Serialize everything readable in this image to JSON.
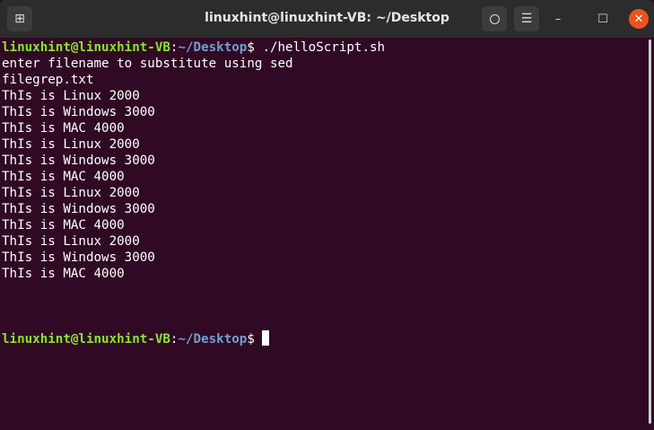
{
  "window": {
    "title": "linuxhint@linuxhint-VB: ~/Desktop"
  },
  "prompt": {
    "user": "linuxhint@linuxhint-VB",
    "sep": ":",
    "path": "~/Desktop",
    "symbol": "$ "
  },
  "command": "./helloScript.sh",
  "output": [
    "enter filename to substitute using sed",
    "filegrep.txt",
    "ThIs is Linux 2000",
    "ThIs is Windows 3000",
    "ThIs is MAC 4000",
    "ThIs is Linux 2000",
    "ThIs is Windows 3000",
    "ThIs is MAC 4000",
    "ThIs is Linux 2000",
    "ThIs is Windows 3000",
    "ThIs is MAC 4000",
    "ThIs is Linux 2000",
    "ThIs is Windows 3000",
    "ThIs is MAC 4000"
  ],
  "icons": {
    "new_tab": "⊞",
    "search": "🔍",
    "menu": "☰",
    "minimize": "–",
    "maximize": "☐",
    "close": "✕"
  }
}
